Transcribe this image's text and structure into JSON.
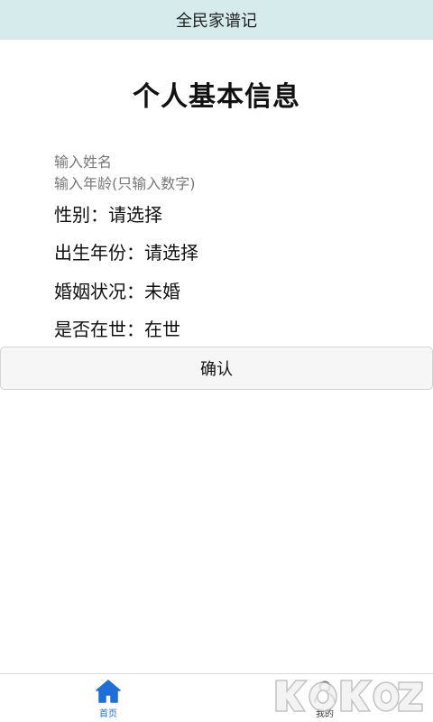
{
  "app": {
    "title": "全民家谱记"
  },
  "page": {
    "heading": "个人基本信息"
  },
  "form": {
    "name_placeholder": "输入姓名",
    "name_value": "",
    "age_placeholder": "输入年龄(只输入数字)",
    "age_value": "",
    "gender": {
      "label": "性别：",
      "value": "请选择"
    },
    "birth_year": {
      "label": "出生年份：",
      "value": "请选择"
    },
    "marital": {
      "label": "婚姻状况：",
      "value": "未婚"
    },
    "alive": {
      "label": "是否在世：",
      "value": "在世"
    },
    "confirm_label": "确认"
  },
  "tabbar": {
    "home_label": "首页",
    "mine_label": "我的",
    "home_icon": "home-icon",
    "mine_icon": "user-icon",
    "active_color": "#1e6fd9"
  },
  "watermark": {
    "text": "KOKOZ.com"
  }
}
